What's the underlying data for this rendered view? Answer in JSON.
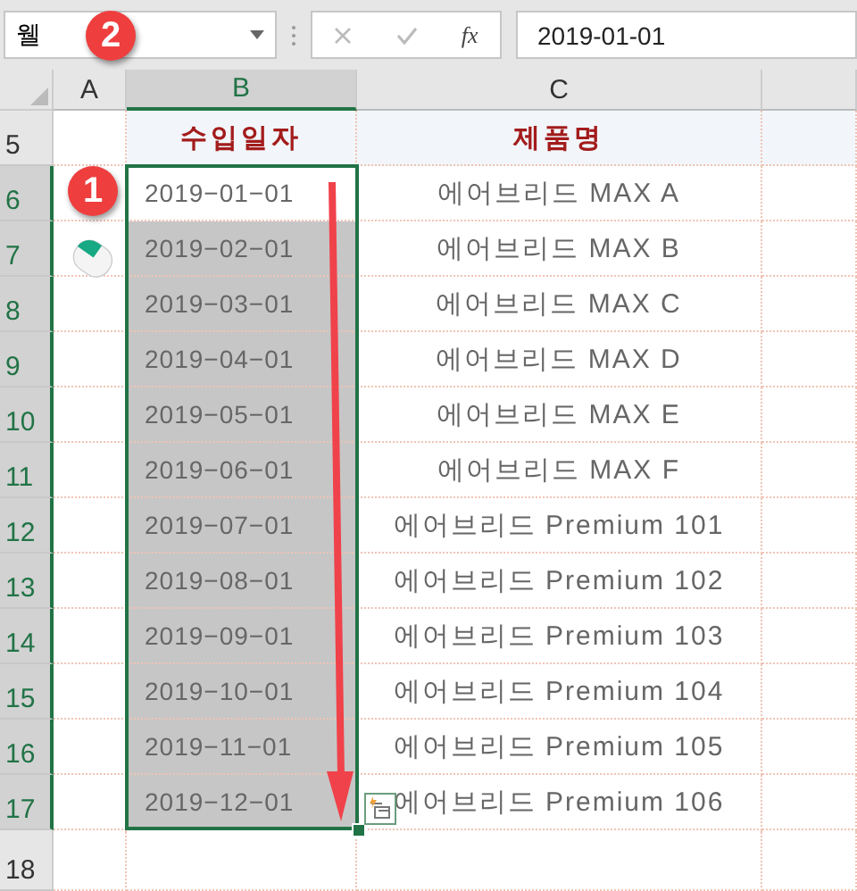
{
  "name_box": {
    "value": "웰"
  },
  "formula_bar": {
    "function_label": "fx",
    "value": "2019-01-01"
  },
  "badges": [
    {
      "label": "2"
    },
    {
      "label": "1"
    }
  ],
  "columns": [
    {
      "label": "A",
      "selected": false
    },
    {
      "label": "B",
      "selected": true
    },
    {
      "label": "C",
      "selected": false
    }
  ],
  "rows": [
    {
      "number": "5",
      "kind": "header",
      "selected": false,
      "date": "수입일자",
      "product": "제품명"
    },
    {
      "number": "6",
      "kind": "data",
      "selected": true,
      "active": true,
      "date": "2019−01−01",
      "product": "에어브리드 MAX A"
    },
    {
      "number": "7",
      "kind": "data",
      "selected": true,
      "active": false,
      "date": "2019−02−01",
      "product": "에어브리드 MAX B"
    },
    {
      "number": "8",
      "kind": "data",
      "selected": true,
      "active": false,
      "date": "2019−03−01",
      "product": "에어브리드 MAX C"
    },
    {
      "number": "9",
      "kind": "data",
      "selected": true,
      "active": false,
      "date": "2019−04−01",
      "product": "에어브리드 MAX D"
    },
    {
      "number": "10",
      "kind": "data",
      "selected": true,
      "active": false,
      "date": "2019−05−01",
      "product": "에어브리드 MAX E"
    },
    {
      "number": "11",
      "kind": "data",
      "selected": true,
      "active": false,
      "date": "2019−06−01",
      "product": "에어브리드 MAX F"
    },
    {
      "number": "12",
      "kind": "data",
      "selected": true,
      "active": false,
      "date": "2019−07−01",
      "product": "에어브리드 Premium 101"
    },
    {
      "number": "13",
      "kind": "data",
      "selected": true,
      "active": false,
      "date": "2019−08−01",
      "product": "에어브리드 Premium 102"
    },
    {
      "number": "14",
      "kind": "data",
      "selected": true,
      "active": false,
      "date": "2019−09−01",
      "product": "에어브리드 Premium 103"
    },
    {
      "number": "15",
      "kind": "data",
      "selected": true,
      "active": false,
      "date": "2019−10−01",
      "product": "에어브리드 Premium 104"
    },
    {
      "number": "16",
      "kind": "data",
      "selected": true,
      "active": false,
      "date": "2019−11−01",
      "product": "에어브리드 Premium 105"
    },
    {
      "number": "17",
      "kind": "data",
      "selected": true,
      "active": false,
      "date": "2019−12−01",
      "product": "에어브리드 Premium 106"
    },
    {
      "number": "18",
      "kind": "empty",
      "selected": false
    }
  ]
}
